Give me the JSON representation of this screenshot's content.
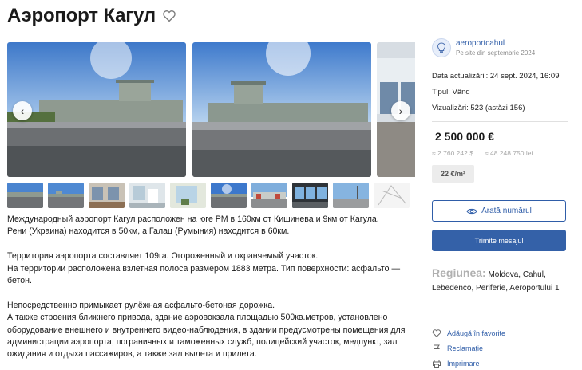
{
  "listing": {
    "title": "Аэропорт Кагул"
  },
  "gallery": {
    "prev_icon": "chevron-left-icon",
    "next_icon": "chevron-right-icon",
    "prev_glyph": "‹",
    "next_glyph": "›",
    "thumbnail_count": 9
  },
  "description": {
    "paragraphs": [
      [
        "Международный аэропорт Кагул расположен на юге РМ в 160км от Кишинева и 9км от Кагула.",
        "Рени (Украина) находится в 50км, а Галац (Румыния) находится в 60км."
      ],
      [
        "Территория аэропорта составляет 109га. Огороженный и охраняемый участок.",
        "На территории расположена взлетная полоса размером 1883 метра. Тип поверхности: асфальто — бетон."
      ],
      [
        "Непосредственно примыкает рулёжная асфальто-бетоная дорожка.",
        "А также строения ближнего привода, здание аэровокзала площадью 500кв.метров, установлено оборудование внешнего и внутреннего видео-наблюдения, в здании предусмотрены помещения для администрации аэропорта, пограничных и таможенных служб, полицейский участок, медпункт, зал ожидания и отдыха пассажиров, а также зал вылета и прилета."
      ]
    ]
  },
  "seller": {
    "name": "aeroportcahul",
    "since": "Pe site din septembrie 2024"
  },
  "info": {
    "updated": "Data actualizării: 24 sept. 2024, 16:09",
    "type": "Tipul: Vând",
    "views": "Vizualizări: 523 (astăzi 156)"
  },
  "price": {
    "main": "2 500 000 €",
    "usd": "≈ 2 760 242 $",
    "mdl": "≈ 48 248 750 lei",
    "per_sqm": "22 €/m²"
  },
  "buttons": {
    "show_number": "Arată numărul",
    "send_message": "Trimite mesajul"
  },
  "region": {
    "label": "Regiunea:",
    "value": "Moldova, Cahul, Lebedenco, Periferie, Aeroportului 1"
  },
  "actions": {
    "favorite": "Adăugă în favorite",
    "complaint": "Reclamație",
    "print": "Imprimare"
  },
  "colors": {
    "accent": "#2f5da8",
    "button_primary": "#3461a8"
  }
}
